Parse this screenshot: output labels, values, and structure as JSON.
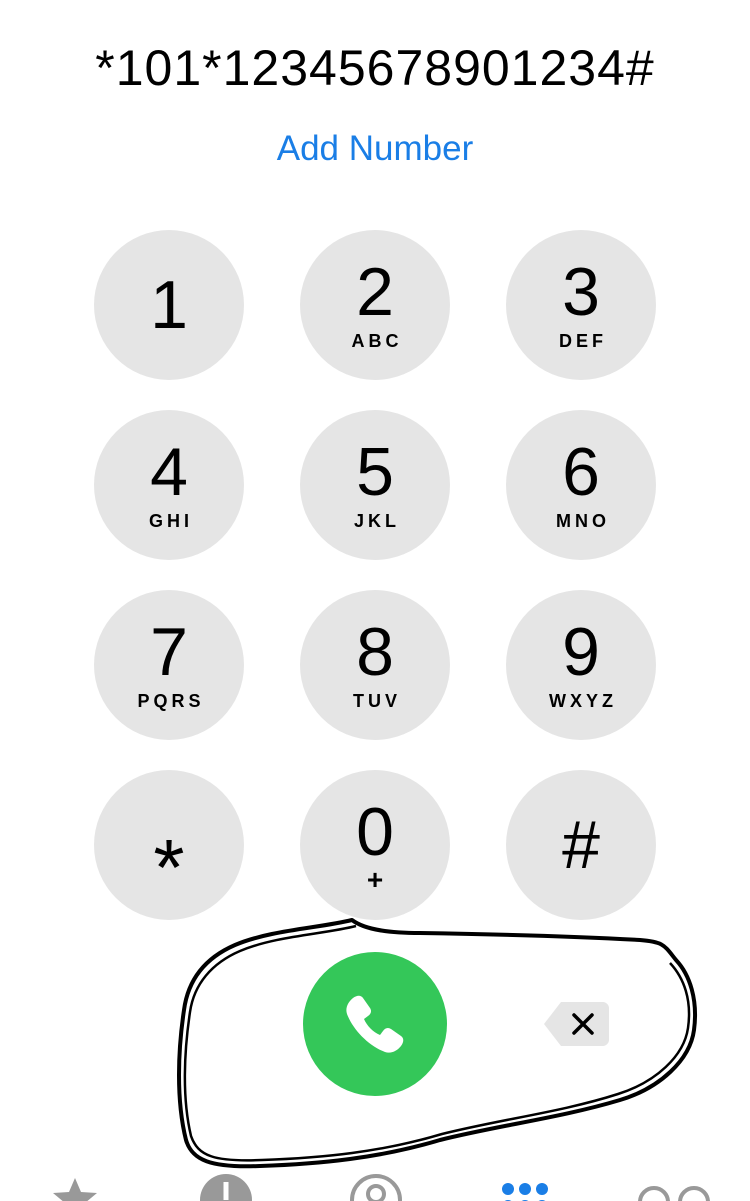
{
  "dialer": {
    "number": "*101*12345678901234#",
    "add_number_label": "Add Number"
  },
  "keypad": {
    "keys": [
      {
        "digit": "1",
        "letters": ""
      },
      {
        "digit": "2",
        "letters": "ABC"
      },
      {
        "digit": "3",
        "letters": "DEF"
      },
      {
        "digit": "4",
        "letters": "GHI"
      },
      {
        "digit": "5",
        "letters": "JKL"
      },
      {
        "digit": "6",
        "letters": "MNO"
      },
      {
        "digit": "7",
        "letters": "PQRS"
      },
      {
        "digit": "8",
        "letters": "TUV"
      },
      {
        "digit": "9",
        "letters": "WXYZ"
      },
      {
        "digit": "*",
        "letters": ""
      },
      {
        "digit": "0",
        "letters": "+"
      },
      {
        "digit": "#",
        "letters": ""
      }
    ]
  },
  "actions": {
    "call_icon": "phone-icon",
    "delete_icon": "backspace-icon"
  },
  "tabs": [
    {
      "name": "favorites",
      "icon": "star-icon",
      "active": false
    },
    {
      "name": "recents",
      "icon": "clock-icon",
      "active": false
    },
    {
      "name": "contacts",
      "icon": "person-circle-icon",
      "active": false
    },
    {
      "name": "keypad",
      "icon": "keypad-icon",
      "active": true
    },
    {
      "name": "voicemail",
      "icon": "voicemail-icon",
      "active": false
    }
  ],
  "colors": {
    "key_background": "#e5e5e5",
    "call_green": "#34c759",
    "accent_blue": "#1a7ee6",
    "tab_inactive": "#999999",
    "tab_active": "#1a7ee6"
  }
}
